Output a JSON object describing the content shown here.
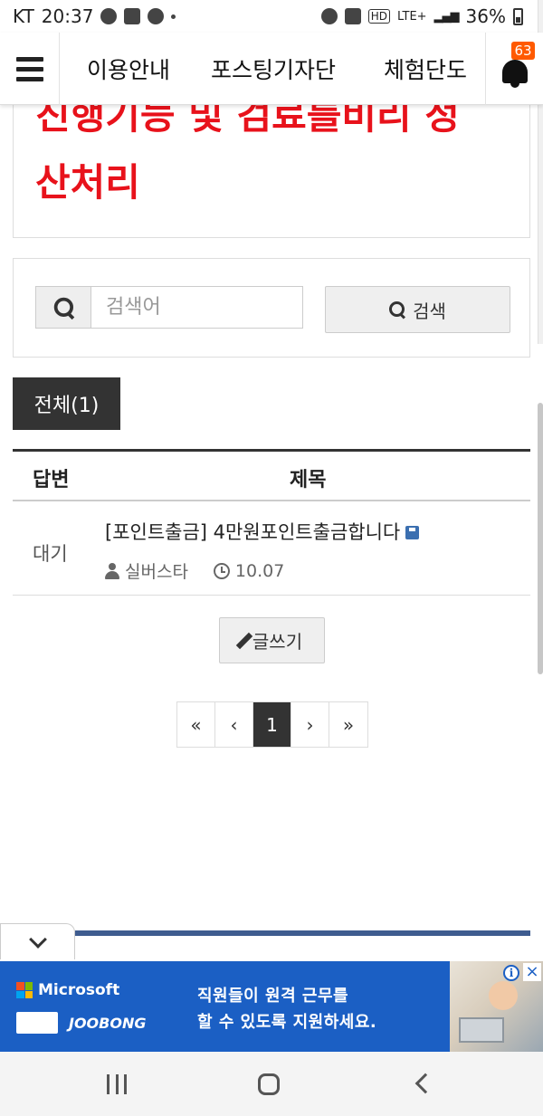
{
  "status_bar": {
    "carrier": "KT",
    "time": "20:37",
    "network": "LTE+",
    "hd": "HD",
    "battery": "36%"
  },
  "top_nav": {
    "links": [
      "이용안내",
      "포스팅기자단",
      "체험단도"
    ],
    "notification_count": "63"
  },
  "post_header": {
    "title_partial": "진행기능 및 검료를비리 정",
    "title_line2": "산처리"
  },
  "search": {
    "placeholder": "검색어",
    "button_label": "검색"
  },
  "category_tab": {
    "label": "전체(1)"
  },
  "table": {
    "columns": [
      "답변",
      "제목"
    ],
    "rows": [
      {
        "status": "대기",
        "title": "[포인트출금] 4만원포인트출금합니다",
        "author": "실버스타",
        "date": "10.07"
      }
    ]
  },
  "write_button": {
    "label": "글쓰기"
  },
  "pagination": {
    "first": "«",
    "prev": "‹",
    "current": "1",
    "next": "›",
    "last": "»"
  },
  "ad": {
    "brand": "Microsoft",
    "partner": "JOOBONG",
    "line1": "직원들이 원격 근무를",
    "line2": "할 수 있도록 지원하세요.",
    "info_icon": "i",
    "close_icon": "×"
  },
  "colors": {
    "title_red": "#e8121b",
    "badge_orange": "#ff5a00",
    "dark_tab": "#333333",
    "ad_blue": "#1b5fc4"
  }
}
